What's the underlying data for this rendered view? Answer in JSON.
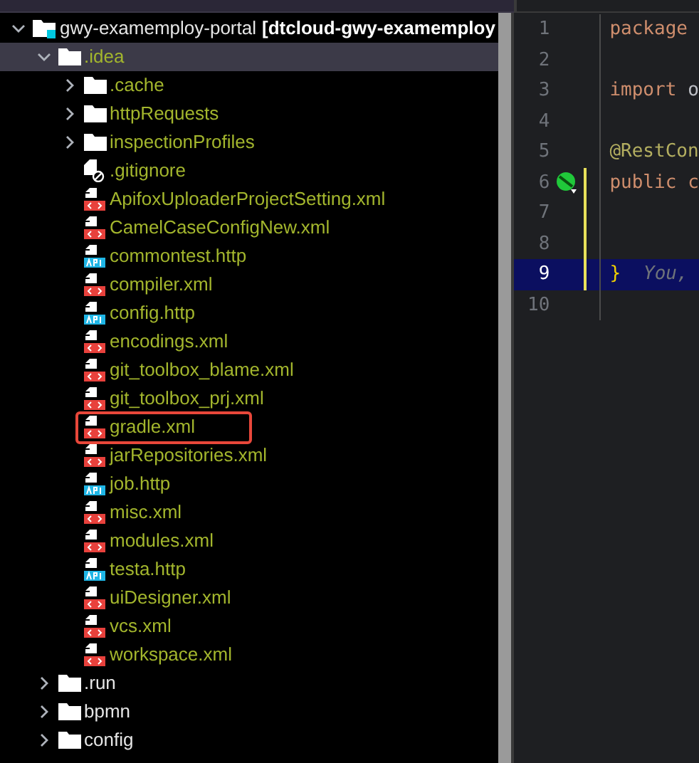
{
  "project_tree": {
    "root": {
      "name": "gwy-examemploy-portal",
      "context": "[dtcloud-gwy-examemploy",
      "expanded": true,
      "children": [
        {
          "name": ".idea",
          "kind": "folder",
          "ignored": true,
          "expanded": true,
          "selected": true,
          "children": [
            {
              "name": ".cache",
              "kind": "folder",
              "ignored": true,
              "expanded": false,
              "selected": false
            },
            {
              "name": "httpRequests",
              "kind": "folder",
              "ignored": true,
              "expanded": false,
              "selected": false
            },
            {
              "name": "inspectionProfiles",
              "kind": "folder",
              "ignored": true,
              "expanded": false,
              "selected": false
            },
            {
              "name": ".gitignore",
              "kind": "gitignore",
              "ignored": true,
              "selected": false
            },
            {
              "name": "ApifoxUploaderProjectSetting.xml",
              "kind": "xml",
              "ignored": true,
              "selected": false
            },
            {
              "name": "CamelCaseConfigNew.xml",
              "kind": "xml",
              "ignored": true,
              "selected": false
            },
            {
              "name": "commontest.http",
              "kind": "http",
              "ignored": true,
              "selected": false
            },
            {
              "name": "compiler.xml",
              "kind": "xml",
              "ignored": true,
              "selected": false
            },
            {
              "name": "config.http",
              "kind": "http",
              "ignored": true,
              "selected": false
            },
            {
              "name": "encodings.xml",
              "kind": "xml",
              "ignored": true,
              "selected": false
            },
            {
              "name": "git_toolbox_blame.xml",
              "kind": "xml",
              "ignored": true,
              "selected": false
            },
            {
              "name": "git_toolbox_prj.xml",
              "kind": "xml",
              "ignored": true,
              "selected": false
            },
            {
              "name": "gradle.xml",
              "kind": "xml",
              "ignored": true,
              "selected": false,
              "highlighted": true
            },
            {
              "name": "jarRepositories.xml",
              "kind": "xml",
              "ignored": true,
              "selected": false
            },
            {
              "name": "job.http",
              "kind": "http",
              "ignored": true,
              "selected": false
            },
            {
              "name": "misc.xml",
              "kind": "xml",
              "ignored": true,
              "selected": false
            },
            {
              "name": "modules.xml",
              "kind": "xml",
              "ignored": true,
              "selected": false
            },
            {
              "name": "testa.http",
              "kind": "http",
              "ignored": true,
              "selected": false
            },
            {
              "name": "uiDesigner.xml",
              "kind": "xml",
              "ignored": true,
              "selected": false
            },
            {
              "name": "vcs.xml",
              "kind": "xml",
              "ignored": true,
              "selected": false
            },
            {
              "name": "workspace.xml",
              "kind": "xml",
              "ignored": true,
              "selected": false
            }
          ]
        },
        {
          "name": ".run",
          "kind": "folder",
          "ignored": false,
          "expanded": false,
          "selected": false
        },
        {
          "name": "bpmn",
          "kind": "folder",
          "ignored": false,
          "expanded": false,
          "selected": false
        },
        {
          "name": "config",
          "kind": "folder",
          "ignored": false,
          "expanded": false,
          "selected": false
        }
      ]
    }
  },
  "editor": {
    "lines": [
      {
        "number": "1",
        "current": false,
        "tokens": [
          {
            "text": "package",
            "kind": "keyword"
          }
        ]
      },
      {
        "number": "2",
        "current": false
      },
      {
        "number": "3",
        "current": false,
        "tokens": [
          {
            "text": "import",
            "kind": "keyword"
          },
          {
            "text": "o",
            "kind": "plain"
          }
        ]
      },
      {
        "number": "4",
        "current": false
      },
      {
        "number": "5",
        "current": false,
        "tokens": [
          {
            "text": "@RestCon",
            "kind": "annotation"
          }
        ]
      },
      {
        "number": "6",
        "current": false,
        "gutter_icon": true,
        "tokens": [
          {
            "text": "public",
            "kind": "keyword"
          },
          {
            "text": "c",
            "kind": "keyword"
          }
        ]
      },
      {
        "number": "7",
        "current": false
      },
      {
        "number": "8",
        "current": false
      },
      {
        "number": "9",
        "current": true,
        "tokens": [
          {
            "text": "}",
            "kind": "brace"
          },
          {
            "text": "You,",
            "kind": "hint"
          }
        ]
      },
      {
        "number": "10",
        "current": false
      }
    ]
  }
}
